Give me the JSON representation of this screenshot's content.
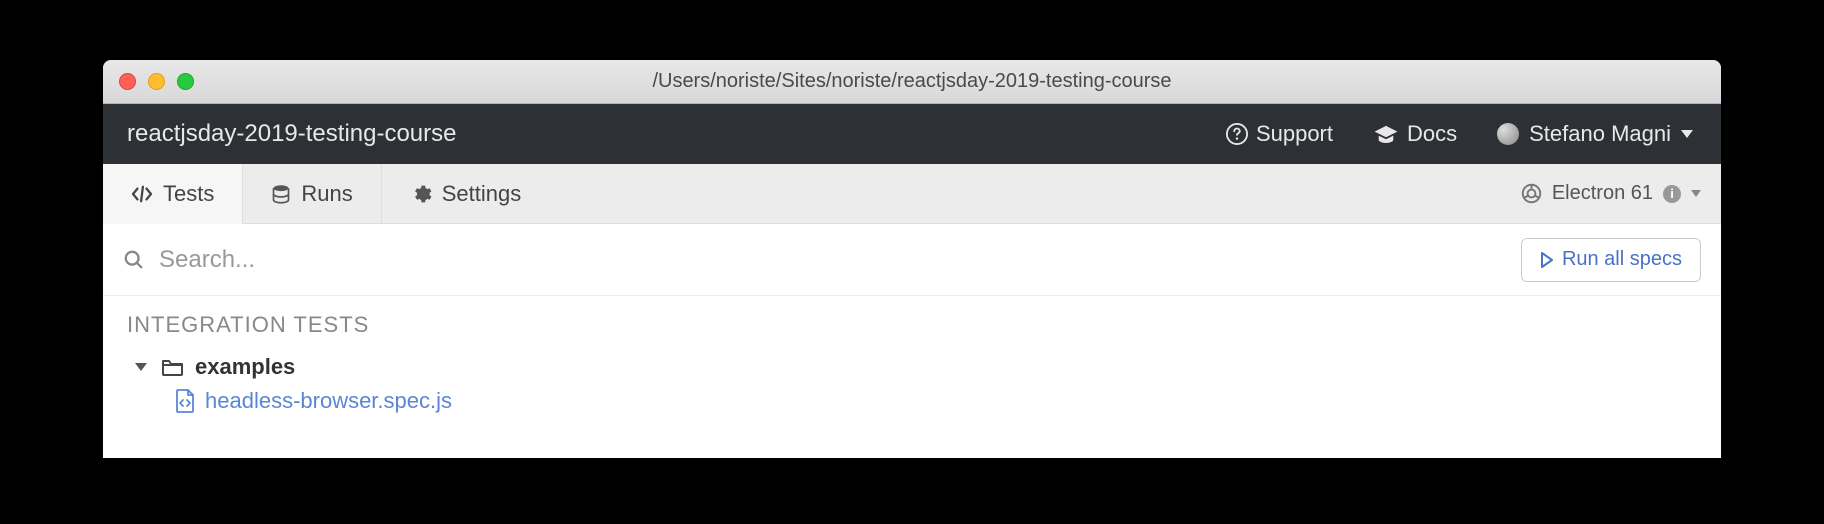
{
  "window": {
    "title": "/Users/noriste/Sites/noriste/reactjsday-2019-testing-course"
  },
  "header": {
    "project": "reactjsday-2019-testing-course",
    "support": "Support",
    "docs": "Docs",
    "user": "Stefano Magni"
  },
  "tabs": {
    "tests": "Tests",
    "runs": "Runs",
    "settings": "Settings",
    "browser": "Electron 61"
  },
  "search": {
    "placeholder": "Search...",
    "run_button": "Run all specs"
  },
  "specs": {
    "section_title": "INTEGRATION TESTS",
    "folder": "examples",
    "file": "headless-browser.spec.js"
  }
}
